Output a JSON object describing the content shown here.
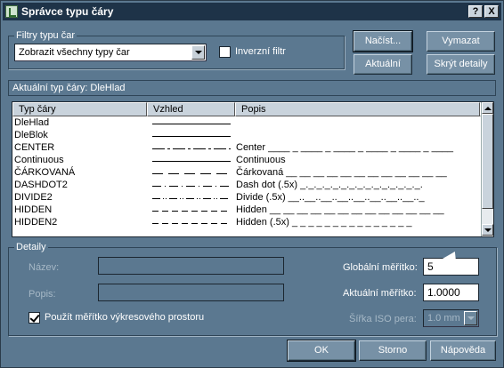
{
  "window": {
    "title": "Správce typu čáry"
  },
  "titlebar": {
    "help_label": "?",
    "close_label": "X"
  },
  "filters": {
    "legend": "Filtry typu čar",
    "selected": "Zobrazit všechny typy čar",
    "invert_label": "Inverzní filtr"
  },
  "buttons": {
    "load": "Načíst...",
    "delete": "Vymazat",
    "current": "Aktuální",
    "hide_details": "Skrýt detaily",
    "ok": "OK",
    "cancel": "Storno",
    "help": "Nápověda"
  },
  "current_linetype": "Aktuální typ čáry:  DleHlad",
  "list": {
    "headers": [
      "Typ čáry",
      "Vzhled",
      "Popis"
    ],
    "rows": [
      {
        "name": "DleHlad",
        "desc": "",
        "pattern": "solid"
      },
      {
        "name": "DleBlok",
        "desc": "",
        "pattern": "solid"
      },
      {
        "name": "CENTER",
        "desc": "Center ____ _ ____ _ ____ _ ____ _ ____ _ ____",
        "pattern": "center"
      },
      {
        "name": "Continuous",
        "desc": "Continuous",
        "pattern": "solid"
      },
      {
        "name": "ČÁRKOVANÁ",
        "desc": "Čárkovaná __ __ __ __ __ __ __ __ __ __ __ __",
        "pattern": "dashed"
      },
      {
        "name": "DASHDOT2",
        "desc": "Dash dot (.5x) _._._._._._._._._._._._._._._.",
        "pattern": "dashdot"
      },
      {
        "name": "DIVIDE2",
        "desc": "Divide (.5x) __..__..__..__..__..__..__..__.._",
        "pattern": "divide"
      },
      {
        "name": "HIDDEN",
        "desc": "Hidden __ __ __ __ __ __ __ __ __ __ __ __ __",
        "pattern": "hidden"
      },
      {
        "name": "HIDDEN2",
        "desc": "Hidden (.5x) _ _ _ _ _ _ _ _ _ _ _ _ _ _ _",
        "pattern": "hidden"
      }
    ]
  },
  "details": {
    "legend": "Detaily",
    "name_label": "Název:",
    "desc_label": "Popis:",
    "paper_scale_label": "Použít měřítko výkresového prostoru",
    "global_scale_label": "Globální měřítko:",
    "global_scale_value": "5",
    "current_scale_label": "Aktuální měřítko:",
    "current_scale_value": "1.0000",
    "iso_pen_label": "Šířka ISO pera:",
    "iso_pen_value": "1.0 mm"
  }
}
